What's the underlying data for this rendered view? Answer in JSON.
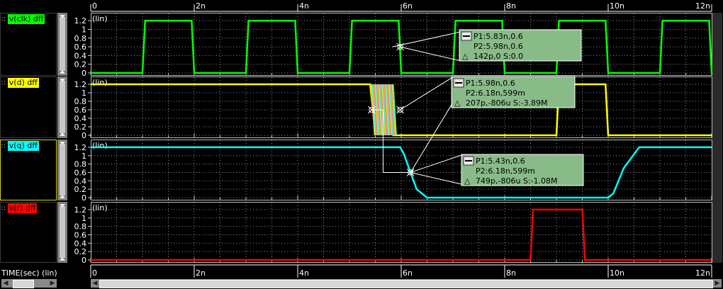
{
  "window": {
    "xaxis_label": "TIME(sec) (lin)"
  },
  "panels": [
    {
      "name": "v(clk) dff",
      "color": "#00ff00",
      "scale": "(lin)",
      "ticks": [
        "1.2",
        "1",
        "0.8",
        "0.6",
        "0.4",
        "0.2",
        "0"
      ]
    },
    {
      "name": "v(d) dff",
      "color": "#ffff00",
      "scale": "(lin)",
      "ticks": [
        "1.2",
        "1",
        "0.8",
        "0.6",
        "0.4",
        "0.2",
        "0"
      ]
    },
    {
      "name": "v(q) dff",
      "color": "#00ffff",
      "scale": "(lin)",
      "ticks": [
        "1.2",
        "1",
        "0.8",
        "0.6",
        "0.4",
        "0.2",
        "0"
      ]
    },
    {
      "name": "v(r) dff",
      "color": "#ff0000",
      "scale": "(lin)",
      "ticks": [
        "1.2",
        "1",
        "0.8",
        "0.6",
        "0.4",
        "0.2",
        "0"
      ]
    }
  ],
  "time_ticks": [
    "0",
    "2n",
    "4n",
    "6n",
    "8n",
    "10n",
    "12n"
  ],
  "measurements": [
    {
      "p1": "P1:5.83n,0.6",
      "p2": "P2:5.98n,0.6",
      "delta": "142p,0 S:0.0"
    },
    {
      "p1": "P1:5.98n,0.6",
      "p2": "P2:6.18n,599m",
      "delta": "207p,-806u S:-3.89M"
    },
    {
      "p1": "P1:5.43n,0.6",
      "p2": "P2:6.18n,599m",
      "delta": "749p,-806u S:-1.08M"
    }
  ],
  "icons": {
    "delta": "delta-icon",
    "cursor": "cursor-icon",
    "scroll_left": "arrow-left-icon",
    "scroll_right": "arrow-right-icon"
  },
  "chart_data": {
    "type": "line",
    "xlabel": "TIME(sec)",
    "xlim": [
      0,
      1.2e-08
    ],
    "ylim": [
      0,
      1.3
    ],
    "series": [
      {
        "name": "v(clk) dff",
        "x": [
          0,
          1e-09,
          1.05e-09,
          1.95e-09,
          2e-09,
          3e-09,
          3.05e-09,
          3.95e-09,
          4e-09,
          5e-09,
          5.05e-09,
          5.95e-09,
          6e-09,
          7e-09,
          7.05e-09,
          7.95e-09,
          8e-09,
          9e-09,
          9.05e-09,
          9.95e-09,
          1e-08,
          1.1e-08,
          1.105e-08,
          1.195e-08,
          1.2e-08
        ],
        "y": [
          0,
          0,
          1.2,
          1.2,
          0,
          0,
          1.2,
          1.2,
          0,
          0,
          1.2,
          1.2,
          0,
          0,
          1.2,
          1.2,
          0,
          0,
          1.2,
          1.2,
          0,
          0,
          1.2,
          1.2,
          0
        ]
      },
      {
        "name": "v(d) dff",
        "x": [
          0,
          5.4e-09,
          5.5e-09,
          5.6e-09,
          5.7e-09,
          5.8e-09,
          5.85e-09,
          9e-09,
          9.05e-09,
          9.95e-09,
          1e-08,
          1.2e-08
        ],
        "y": [
          1.2,
          1.2,
          0.05,
          1.15,
          0.1,
          1.1,
          0,
          0,
          1.2,
          1.2,
          0,
          0
        ]
      },
      {
        "name": "v(q) dff",
        "x": [
          0,
          5.98e-09,
          6.05e-09,
          6.18e-09,
          6.3e-09,
          6.5e-09,
          1e-08,
          1.01e-08,
          1.03e-08,
          1.06e-08,
          1.2e-08
        ],
        "y": [
          1.2,
          1.2,
          1.05,
          0.6,
          0.2,
          0,
          0,
          0.1,
          0.7,
          1.2,
          1.2
        ]
      },
      {
        "name": "v(r) dff",
        "x": [
          0,
          8.5e-09,
          8.55e-09,
          9.5e-09,
          9.55e-09,
          1.2e-08
        ],
        "y": [
          0,
          0,
          1.2,
          1.2,
          0,
          0
        ]
      }
    ]
  }
}
